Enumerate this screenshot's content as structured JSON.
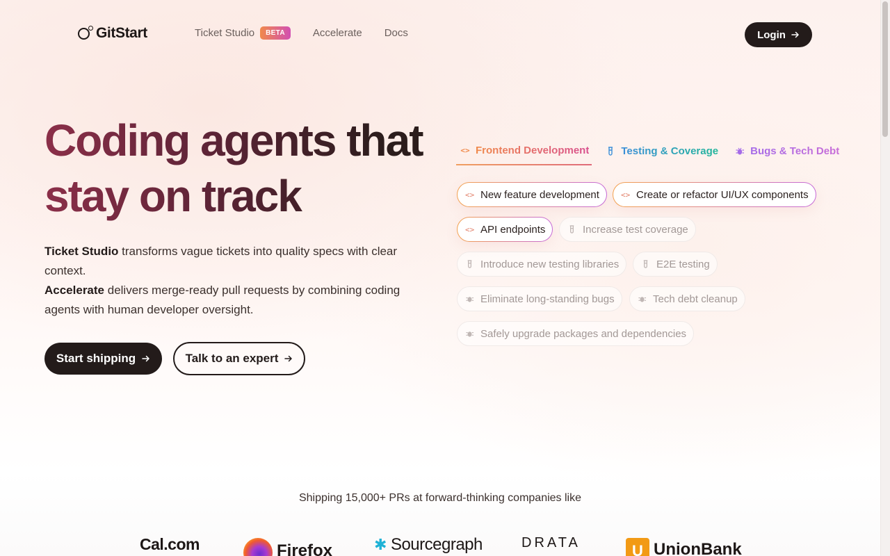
{
  "brand": {
    "name": "GitStart"
  },
  "nav": {
    "items": [
      {
        "label": "Ticket Studio",
        "badge": "BETA"
      },
      {
        "label": "Accelerate"
      },
      {
        "label": "Docs"
      }
    ],
    "login_label": "Login"
  },
  "hero": {
    "title_line1": "Coding agents that",
    "title_line2": "stay on track",
    "desc": {
      "p1_bold": "Ticket Studio",
      "p1_rest": " transforms vague tickets into quality specs with clear context.",
      "p2_bold": "Accelerate",
      "p2_rest": " delivers merge-ready pull requests by combining coding agents with human developer oversight."
    },
    "cta_primary": "Start shipping",
    "cta_secondary": "Talk to an expert"
  },
  "panel": {
    "tabs": [
      {
        "label": "Frontend Development",
        "icon": "code-icon",
        "active": true
      },
      {
        "label": "Testing & Coverage",
        "icon": "test-tube-icon",
        "active": false
      },
      {
        "label": "Bugs & Tech Debt",
        "icon": "bug-icon",
        "active": false
      }
    ],
    "chips": [
      {
        "label": "New feature development",
        "icon": "code-icon",
        "active": true
      },
      {
        "label": "Create or refactor UI/UX components",
        "icon": "code-icon",
        "active": true
      },
      {
        "label": "API endpoints",
        "icon": "code-icon",
        "active": true
      },
      {
        "label": "Increase test coverage",
        "icon": "test-tube-icon",
        "active": false
      },
      {
        "label": "Introduce new testing libraries",
        "icon": "test-tube-icon",
        "active": false
      },
      {
        "label": "E2E testing",
        "icon": "test-tube-icon",
        "active": false
      },
      {
        "label": "Eliminate long-standing bugs",
        "icon": "bug-icon",
        "active": false
      },
      {
        "label": "Tech debt cleanup",
        "icon": "bug-icon",
        "active": false
      },
      {
        "label": "Safely upgrade packages and dependencies",
        "icon": "bug-icon",
        "active": false
      }
    ]
  },
  "customers": {
    "tagline": "Shipping 15,000+ PRs at forward-thinking companies like",
    "logos": [
      "Cal.com",
      "Firefox",
      "Sourcegraph",
      "DRATA",
      "UnionBank"
    ]
  },
  "colors": {
    "dark": "#231b1a",
    "title_gradient_start": "#8b2f49",
    "frontend_accent": "#f08a4b",
    "testing_accent": "#3b8ed8",
    "bugs_accent": "#a56be8"
  }
}
